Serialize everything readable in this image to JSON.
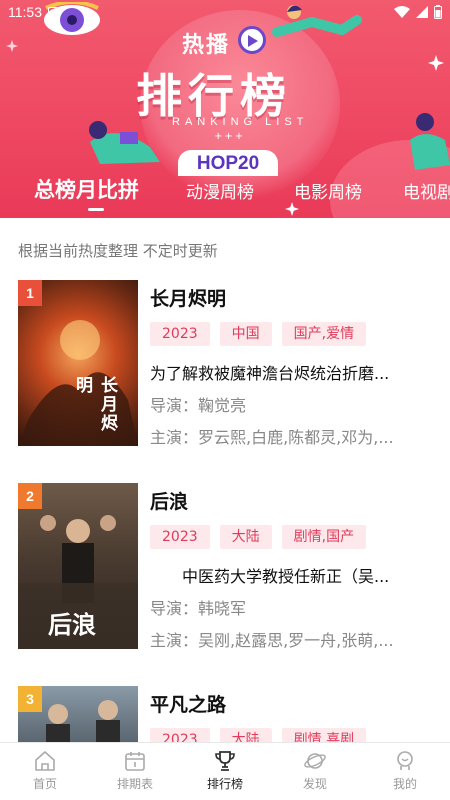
{
  "status_bar": {
    "time": "11:53",
    "notification_icon": "A"
  },
  "header": {
    "hot_label": "热播",
    "title": "排行榜",
    "subtitle": "RANKING LIST",
    "plus_marks": "+++",
    "hop_label": "HOP20",
    "tabs": [
      {
        "label": "总榜月比拼",
        "active": true
      },
      {
        "label": "动漫周榜",
        "active": false
      },
      {
        "label": "电影周榜",
        "active": false
      },
      {
        "label": "电视剧",
        "active": false
      }
    ]
  },
  "note": "根据当前热度整理 不定时更新",
  "items": [
    {
      "rank": "1",
      "rank_color": "#e8503a",
      "title": "长月烬明",
      "tags": [
        "2023",
        "中国",
        "国产,爱情"
      ],
      "desc": "为了解救被魔神澹台烬统治折磨...",
      "director": "导演：鞠觉亮",
      "actors": "主演：罗云熙,白鹿,陈都灵,邓为,...",
      "poster_text": "长月烬明"
    },
    {
      "rank": "2",
      "rank_color": "#ef7a2f",
      "title": "后浪",
      "tags": [
        "2023",
        "大陆",
        "剧情,国产"
      ],
      "desc": "　　中医药大学教授任新正（吴...",
      "director": "导演：韩晓军",
      "actors": "主演：吴刚,赵露思,罗一舟,张萌,...",
      "poster_text": "后浪"
    },
    {
      "rank": "3",
      "rank_color": "#f2b233",
      "title": "平凡之路",
      "tags": [
        "2023",
        "大陆",
        "剧情,喜剧"
      ],
      "desc": "",
      "director": "",
      "actors": "",
      "poster_text": ""
    }
  ],
  "bottom_nav": [
    {
      "label": "首页",
      "icon": "home-icon",
      "active": false
    },
    {
      "label": "排期表",
      "icon": "calendar-icon",
      "active": false
    },
    {
      "label": "排行榜",
      "icon": "trophy-icon",
      "active": true
    },
    {
      "label": "发现",
      "icon": "planet-icon",
      "active": false
    },
    {
      "label": "我的",
      "icon": "profile-icon",
      "active": false
    }
  ]
}
